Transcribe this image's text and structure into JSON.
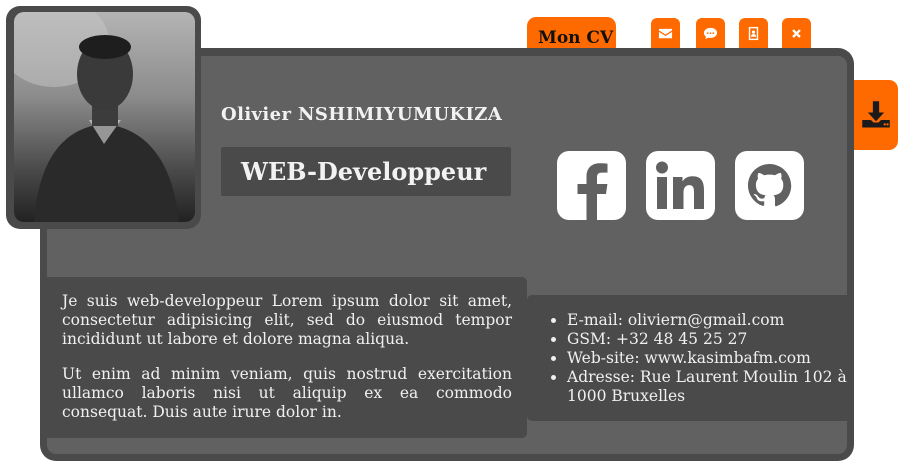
{
  "header": {
    "cv_tab_label": "Mon CV",
    "buttons": [
      "envelope-icon",
      "comment-icon",
      "address-book-icon",
      "close-icon"
    ],
    "download_icon": "download-icon",
    "accent_color": "#ff6a00"
  },
  "profile": {
    "name": "Olivier NSHIMIYUMUKIZA",
    "role": "WEB-Developpeur",
    "photo": "profile-photo"
  },
  "social": [
    "facebook-icon",
    "linkedin-icon",
    "github-icon"
  ],
  "about": {
    "paragraphs": [
      "Je suis web-developpeur Lorem ipsum dolor sit amet, consectetur adipisicing elit, sed do eiusmod tempor incididunt ut labore et dolore magna aliqua.",
      "Ut enim ad minim veniam, quis nostrud exercitation ullamco laboris nisi ut aliquip ex ea commodo consequat. Duis aute irure dolor in."
    ]
  },
  "contact": {
    "items": [
      "E-mail: oliviern@gmail.com",
      "GSM: +32 48 45 25 27",
      "Web-site: www.kasimbafm.com",
      "Adresse: Rue Laurent Moulin 102 à 1000 Bruxelles"
    ]
  }
}
